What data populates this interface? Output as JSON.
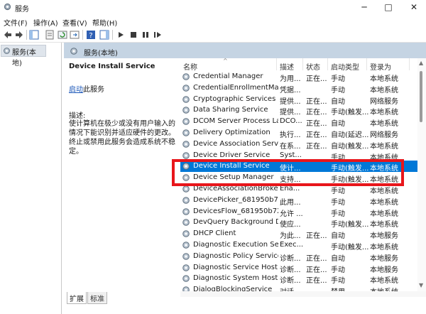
{
  "window": {
    "title": "服务",
    "minimize_glyph": "─",
    "maximize_glyph": "□",
    "close_glyph": "✕"
  },
  "menu": [
    "文件(F)",
    "操作(A)",
    "查看(V)",
    "帮助(H)"
  ],
  "toolbar": {
    "icons": [
      "back-arrow-icon",
      "forward-arrow-icon",
      "show-console-tree-icon",
      "properties-sheet-icon",
      "refresh-icon",
      "export-list-icon",
      "help-icon",
      "show-action-pane-icon",
      "start-service-icon",
      "stop-service-icon",
      "pause-service-icon",
      "restart-service-icon"
    ]
  },
  "left_pane": {
    "tree_item": "服务(本地)"
  },
  "right_pane": {
    "header": "服务(本地)",
    "selected_service": "Device Install Service",
    "start_link": "启动",
    "start_link_suffix": "此服务",
    "description_label": "描述:",
    "description": "使计算机在极少或没有用户输入的情况下能识别并适应硬件的更改。终止或禁用此服务会造成系统不稳定。"
  },
  "table": {
    "columns": [
      "名称",
      "描述",
      "状态",
      "启动类型",
      "登录为"
    ],
    "rows": [
      [
        "Credential Manager",
        "为用...",
        "正在...",
        "手动",
        "本地系统"
      ],
      [
        "CredentialEnrollmentMan...",
        "凭据...",
        "",
        "手动",
        "本地系统"
      ],
      [
        "Cryptographic Services",
        "提供...",
        "正在...",
        "自动",
        "网络服务"
      ],
      [
        "Data Sharing Service",
        "提供...",
        "正在...",
        "手动(触发...",
        "本地系统"
      ],
      [
        "DCOM Server Process La...",
        "DCO...",
        "正在...",
        "自动",
        "本地系统"
      ],
      [
        "Delivery Optimization",
        "执行...",
        "正在...",
        "自动(延迟...",
        "网络服务"
      ],
      [
        "Device Association Service",
        "在系...",
        "正在...",
        "自动(触发...",
        "本地系统"
      ],
      [
        "Device Driver Service",
        "Syst...",
        "",
        "手动",
        "本地系统"
      ],
      [
        "Device Install Service",
        "使计...",
        "",
        "手动(触发...",
        "本地系统"
      ],
      [
        "Device Setup Manager",
        "支持...",
        "",
        "手动(触发...",
        "本地系统"
      ],
      [
        "DeviceAssociationBroker...",
        "Ena...",
        "",
        "手动",
        "本地系统"
      ],
      [
        "DevicePicker_681950b72",
        "此用...",
        "",
        "手动",
        "本地系统"
      ],
      [
        "DevicesFlow_681950b72",
        "允许 ...",
        "",
        "手动",
        "本地系统"
      ],
      [
        "DevQuery Background D...",
        "使应...",
        "",
        "手动(触发...",
        "本地系统"
      ],
      [
        "DHCP Client",
        "为此...",
        "正在...",
        "自动",
        "本地服务"
      ],
      [
        "Diagnostic Execution Ser...",
        "Exec...",
        "",
        "手动(触发...",
        "本地系统"
      ],
      [
        "Diagnostic Policy Service",
        "诊断...",
        "正在...",
        "自动",
        "本地服务"
      ],
      [
        "Diagnostic Service Host",
        "诊断...",
        "正在...",
        "手动",
        "本地服务"
      ],
      [
        "Diagnostic System Host",
        "诊断...",
        "正在...",
        "手动",
        "本地系统"
      ],
      [
        "DialogBlockingService",
        "对话...",
        "",
        "禁用",
        "本地系统"
      ]
    ],
    "selected_index": 8
  },
  "tabs": [
    "扩展",
    "标准"
  ],
  "colors": {
    "selection": "#0078d7",
    "header_band": "#c5d4e3",
    "highlight_box": "#e8161b",
    "link": "#1a56b8"
  }
}
